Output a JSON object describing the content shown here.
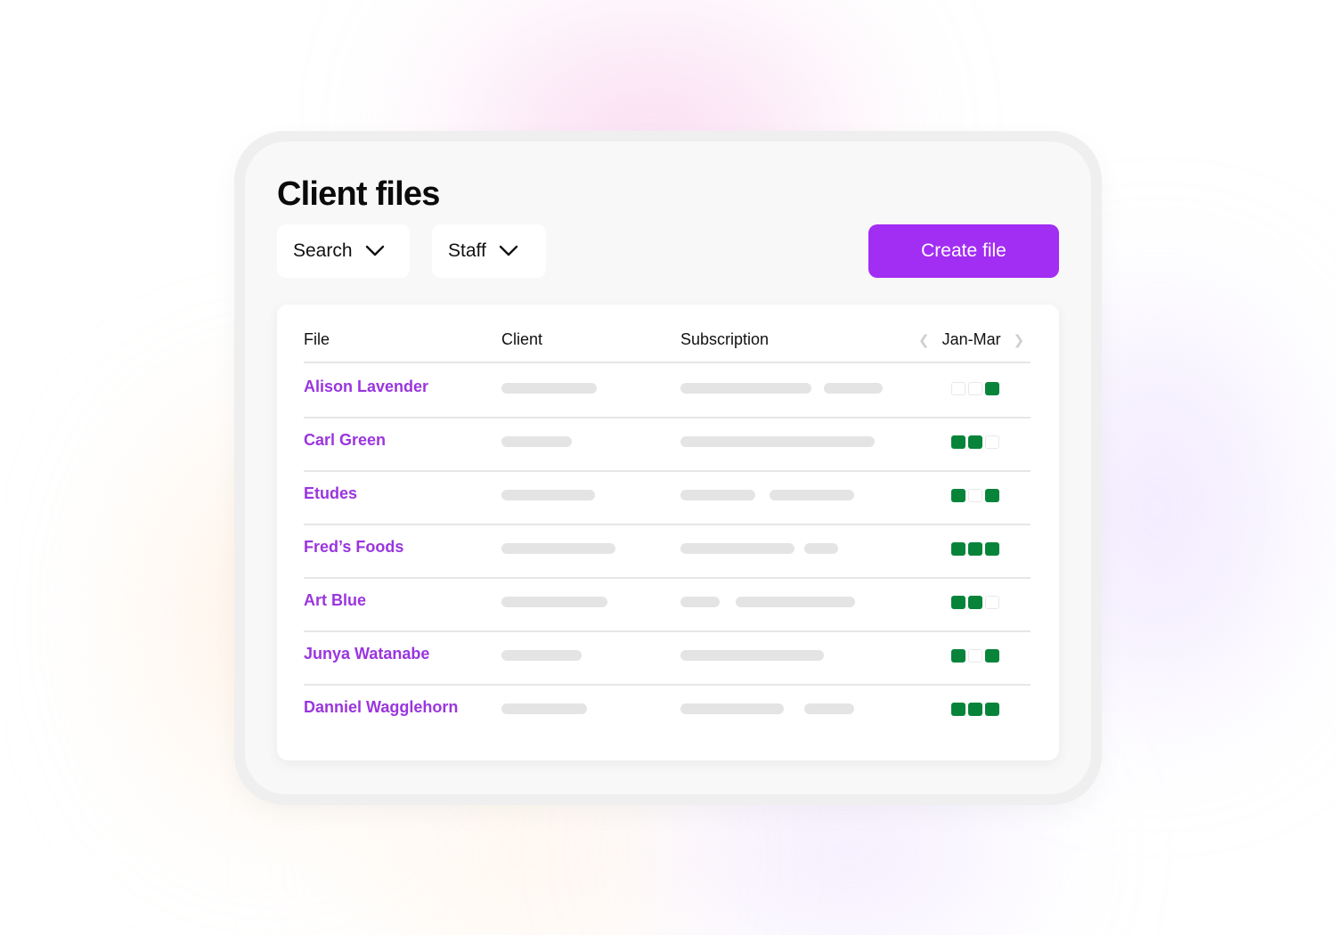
{
  "page": {
    "title": "Client files"
  },
  "filters": {
    "search_label": "Search",
    "staff_label": "Staff",
    "chevron_icon": "chevron-down-icon"
  },
  "actions": {
    "create_label": "Create file"
  },
  "colors": {
    "accent": "#a22df3",
    "link": "#9a35de",
    "status_on": "#07843a",
    "status_off": "#ffffff",
    "placeholder_bar": "#e4e4e4"
  },
  "table": {
    "columns": {
      "file": "File",
      "client": "Client",
      "subscription": "Subscription",
      "period": "Jan-Mar",
      "prev_icon": "chevron-left-icon",
      "next_icon": "chevron-right-icon"
    },
    "rows": [
      {
        "file": "Alison Lavender",
        "months": [
          false,
          false,
          true
        ]
      },
      {
        "file": "Carl Green",
        "months": [
          true,
          true,
          false
        ]
      },
      {
        "file": "Etudes",
        "months": [
          true,
          false,
          true
        ]
      },
      {
        "file": "Fred’s Foods",
        "months": [
          true,
          true,
          true
        ]
      },
      {
        "file": "Art Blue",
        "months": [
          true,
          true,
          false
        ]
      },
      {
        "file": "Junya Watanabe",
        "months": [
          true,
          false,
          true
        ]
      },
      {
        "file": "Danniel Wagglehorn",
        "months": [
          true,
          true,
          true
        ]
      }
    ]
  }
}
